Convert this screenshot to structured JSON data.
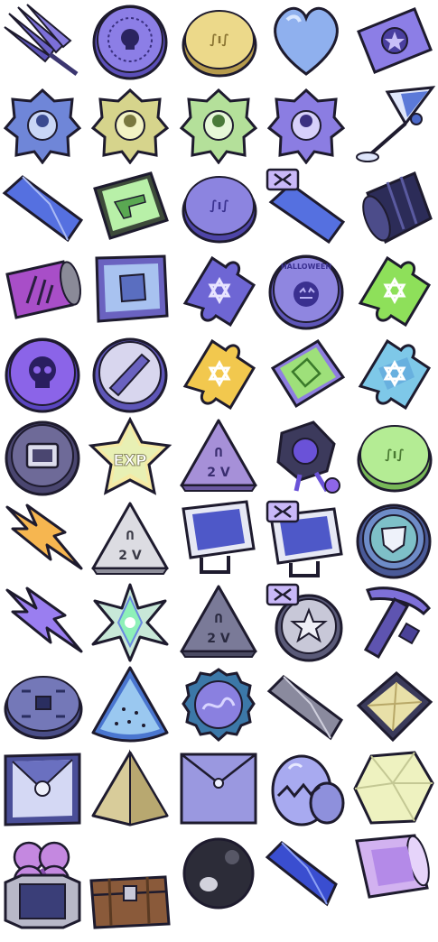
{
  "sprite_sheet": {
    "items": [
      {
        "icon": "lavender-bundle-icon"
      },
      {
        "icon": "purple-skull-coin-icon"
      },
      {
        "icon": "gold-coin-icon"
      },
      {
        "icon": "blue-heart-icon"
      },
      {
        "icon": "purple-star-ticket-icon"
      },
      {
        "icon": "blue-guardian-badge-icon"
      },
      {
        "icon": "yellow-guardian-badge-icon"
      },
      {
        "icon": "green-guardian-badge-icon"
      },
      {
        "icon": "purple-guardian-badge-icon"
      },
      {
        "icon": "cocktail-glass-icon"
      },
      {
        "icon": "blue-crystal-shard-icon"
      },
      {
        "icon": "green-gun-card-icon"
      },
      {
        "icon": "purple-coin-icon"
      },
      {
        "icon": "bound-crystal-shard-icon"
      },
      {
        "icon": "dark-barrel-icon"
      },
      {
        "icon": "purple-can-icon"
      },
      {
        "icon": "fist-card-icon"
      },
      {
        "icon": "purple-puzzle-piece-icon"
      },
      {
        "icon": "halloween-coin-icon"
      },
      {
        "icon": "green-puzzle-piece-icon"
      },
      {
        "icon": "purple-skull-token-icon"
      },
      {
        "icon": "wrench-coin-icon"
      },
      {
        "icon": "yellow-puzzle-piece-icon"
      },
      {
        "icon": "green-rune-card-icon"
      },
      {
        "icon": "holo-puzzle-piece-icon"
      },
      {
        "icon": "dark-badge-coin-icon"
      },
      {
        "icon": "exp-star-icon"
      },
      {
        "icon": "purple-triangle-token-icon"
      },
      {
        "icon": "dark-gadget-icon"
      },
      {
        "icon": "green-coin-icon"
      },
      {
        "icon": "orange-lightning-icon"
      },
      {
        "icon": "white-triangle-token-icon"
      },
      {
        "icon": "blue-scanner-icon"
      },
      {
        "icon": "bound-scanner-icon"
      },
      {
        "icon": "shield-coin-icon"
      },
      {
        "icon": "purple-lightning-icon"
      },
      {
        "icon": "prism-star-icon"
      },
      {
        "icon": "grey-triangle-token-icon"
      },
      {
        "icon": "bound-star-coin-icon"
      },
      {
        "icon": "purple-pickaxe-icon"
      },
      {
        "icon": "ancient-coin-icon"
      },
      {
        "icon": "watermelon-slice-icon"
      },
      {
        "icon": "bottle-cap-icon"
      },
      {
        "icon": "grey-crystal-shard-icon"
      },
      {
        "icon": "gold-gem-icon"
      },
      {
        "icon": "sealed-box-icon"
      },
      {
        "icon": "tan-pyramid-icon"
      },
      {
        "icon": "envelope-icon"
      },
      {
        "icon": "cracked-egg-icon"
      },
      {
        "icon": "pale-rock-icon"
      },
      {
        "icon": "pink-clover-icon"
      },
      {
        "icon": "black-pearl-icon"
      },
      {
        "icon": "blue-gem-shard-icon"
      },
      {
        "icon": "pink-jar-icon"
      },
      {
        "icon": "silver-frame-icon"
      },
      {
        "icon": "treasure-chest-icon"
      }
    ],
    "texts": {
      "halloween": "HALLOWEEN",
      "exp": "EXP",
      "tri_top": "Ո",
      "tri_bottom": "2 V",
      "coin_engrave": "∫ı∫"
    },
    "colors": {
      "outline": "#1e1b2e",
      "purple": "#7c6fd8",
      "lavender": "#a99cf0",
      "gold": "#e8d47c",
      "blue": "#8fa6ee",
      "green": "#a8e08a",
      "orange": "#f2b64a",
      "grey": "#8a8aa0"
    }
  }
}
